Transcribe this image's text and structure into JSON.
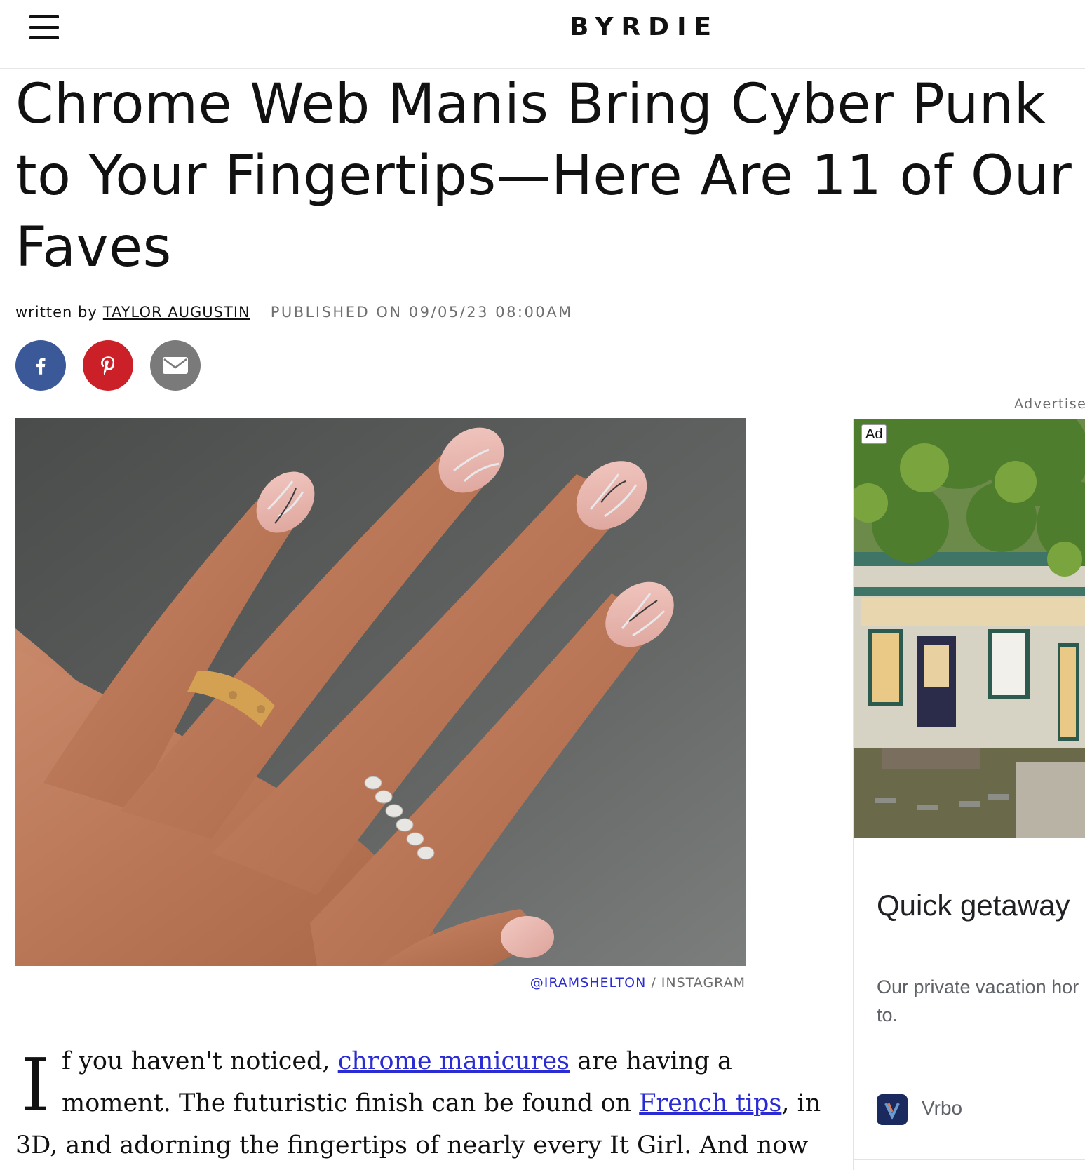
{
  "header": {
    "logo": "BYRDIE",
    "menu_icon": "hamburger-menu-icon"
  },
  "article": {
    "title_lines": [
      "Chrome Web Manis Bring Cyber Punk",
      "to Your Fingertips—Here Are 11 of Our",
      "Faves"
    ],
    "byline_prefix": "written by",
    "author": "TAYLOR AUGUSTIN",
    "published": "PUBLISHED ON 09/05/23 08:00AM",
    "share": [
      {
        "name": "facebook",
        "icon": "facebook-icon",
        "color": "#3b5998"
      },
      {
        "name": "pinterest",
        "icon": "pinterest-icon",
        "color": "#cb2027"
      },
      {
        "name": "email",
        "icon": "email-icon",
        "color": "#7a7a7a"
      }
    ],
    "image_credit_link": "@IRAMSHELTON",
    "image_credit_sep": " / ",
    "image_credit_source": "INSTAGRAM",
    "body": {
      "dropcap": "I",
      "line1_a": "f you haven't noticed, ",
      "line1_link": "chrome manicures",
      "line1_b": " are having a",
      "line2_a": "moment. The futuristic finish can be found on ",
      "line2_link": "French tips",
      "line2_b": ", in",
      "line3": "3D, and adorning the fingertips of nearly every It Girl. And now"
    }
  },
  "ad": {
    "label": "Advertisen",
    "badge": "Ad",
    "headline": "Quick getaway",
    "desc_line1": "Our private vacation hor",
    "desc_line2": "to.",
    "brand": "Vrbo"
  },
  "colors": {
    "link": "#2b2bd4",
    "muted": "#6d6d6d"
  }
}
